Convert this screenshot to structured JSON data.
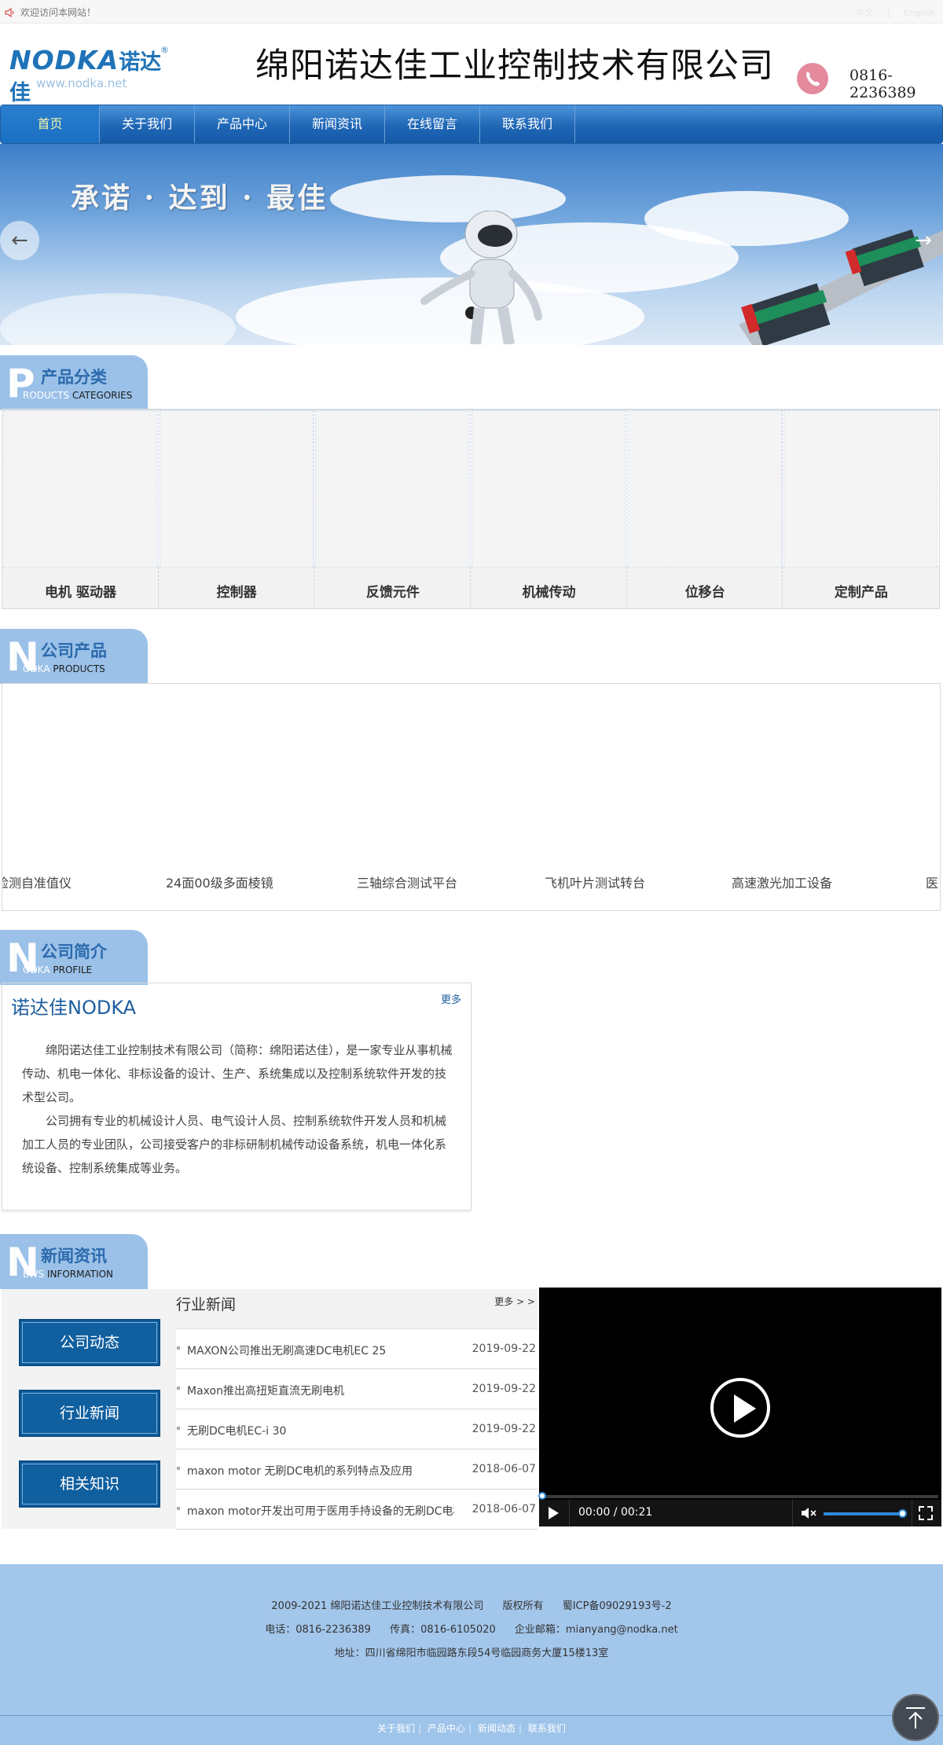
{
  "topbar": {
    "welcome": "欢迎访问本网站！",
    "lang_cn": "中文",
    "lang_en": "English"
  },
  "header": {
    "logo_brand": "NODKA",
    "logo_cn": "诺达佳",
    "logo_reg": "®",
    "logo_url": "www.nodka.net",
    "company_name": "绵阳诺达佳工业控制技术有限公司",
    "phone": "0816-2236389"
  },
  "nav": {
    "items": [
      {
        "label": "首页"
      },
      {
        "label": "关于我们"
      },
      {
        "label": "产品中心"
      },
      {
        "label": "新闻资讯"
      },
      {
        "label": "在线留言"
      },
      {
        "label": "联系我们"
      }
    ]
  },
  "banner": {
    "slogan": "承诺 · 达到 · 最佳",
    "prev": "←",
    "next": "→"
  },
  "categories_section": {
    "big_letter": "P",
    "title_cn": "产品分类",
    "title_en_a": "RODUCTS",
    "title_en_b": "CATEGORIES",
    "items": [
      {
        "label": "电机 驱动器"
      },
      {
        "label": "控制器"
      },
      {
        "label": "反馈元件"
      },
      {
        "label": "机械传动"
      },
      {
        "label": "位移台"
      },
      {
        "label": "定制产品"
      }
    ]
  },
  "products_section": {
    "big_letter": "N",
    "title_cn": "公司产品",
    "title_en_a": "ODKA",
    "title_en_b": "PRODUCTS",
    "items": [
      {
        "label": "光电检测自准值仪"
      },
      {
        "label": "24面00级多面棱镜"
      },
      {
        "label": "三轴综合测试平台"
      },
      {
        "label": "飞机叶片测试转台"
      },
      {
        "label": "高速激光加工设备"
      },
      {
        "label": "医"
      }
    ]
  },
  "profile_section": {
    "big_letter": "N",
    "title_cn": "公司简介",
    "title_en_a": "ODKA",
    "title_en_b": "PROFILE",
    "heading": "诺达佳NODKA",
    "more": "更多",
    "para1": "绵阳诺达佳工业控制技术有限公司（简称：绵阳诺达佳），是一家专业从事机械传动、机电一体化、非标设备的设计、生产、系统集成以及控制系统软件开发的技术型公司。",
    "para2": "公司拥有专业的机械设计人员、电气设计人员、控制系统软件开发人员和机械加工人员的专业团队，公司接受客户的非标研制机械传动设备系统，机电一体化系统设备、控制系统集成等业务。"
  },
  "news_section": {
    "big_letter": "N",
    "title_cn": "新闻资讯",
    "title_en_a": "EWS",
    "title_en_b": "INFORMATION",
    "side_buttons": [
      {
        "label": "公司动态"
      },
      {
        "label": "行业新闻"
      },
      {
        "label": "相关知识"
      }
    ],
    "list_title": "行业新闻",
    "list_more": "更多 > >",
    "rows": [
      {
        "title": "MAXON公司推出无刷高速DC电机EC 25",
        "date": "2019-09-22"
      },
      {
        "title": "Maxon推出高扭矩直流无刷电机",
        "date": "2019-09-22"
      },
      {
        "title": "无刷DC电机EC-i 30",
        "date": "2019-09-22"
      },
      {
        "title": "maxon motor 无刷DC电机的系列特点及应用",
        "date": "2018-06-07"
      },
      {
        "title": "maxon motor开发出可用于医用手持设备的无刷DC电机",
        "date": "2018-06-07"
      }
    ],
    "video": {
      "time": "00:00 / 00:21",
      "progress": 0.0,
      "volume": 1.0
    }
  },
  "footer": {
    "copyright": "2009-2021 绵阳诺达佳工业控制技术有限公司",
    "rights": "版权所有",
    "icp": "蜀ICP备09029193号-2",
    "tel": "电话：0816-2236389",
    "fax": "传真：0816-6105020",
    "email": "企业邮箱：mianyang@nodka.net",
    "address": "地址：四川省绵阳市临园路东段54号临园商务大厦15楼13室",
    "links": [
      {
        "label": "关于我们"
      },
      {
        "label": "产品中心"
      },
      {
        "label": "新闻动态"
      },
      {
        "label": "联系我们"
      }
    ],
    "link_sep": "|"
  },
  "colors": {
    "brand_blue": "#1f73b8",
    "nav_blue": "#1f66b5",
    "section_tab": "#9bc1e8",
    "news_button": "#105f9f",
    "footer_bg": "#a3c6eb"
  }
}
